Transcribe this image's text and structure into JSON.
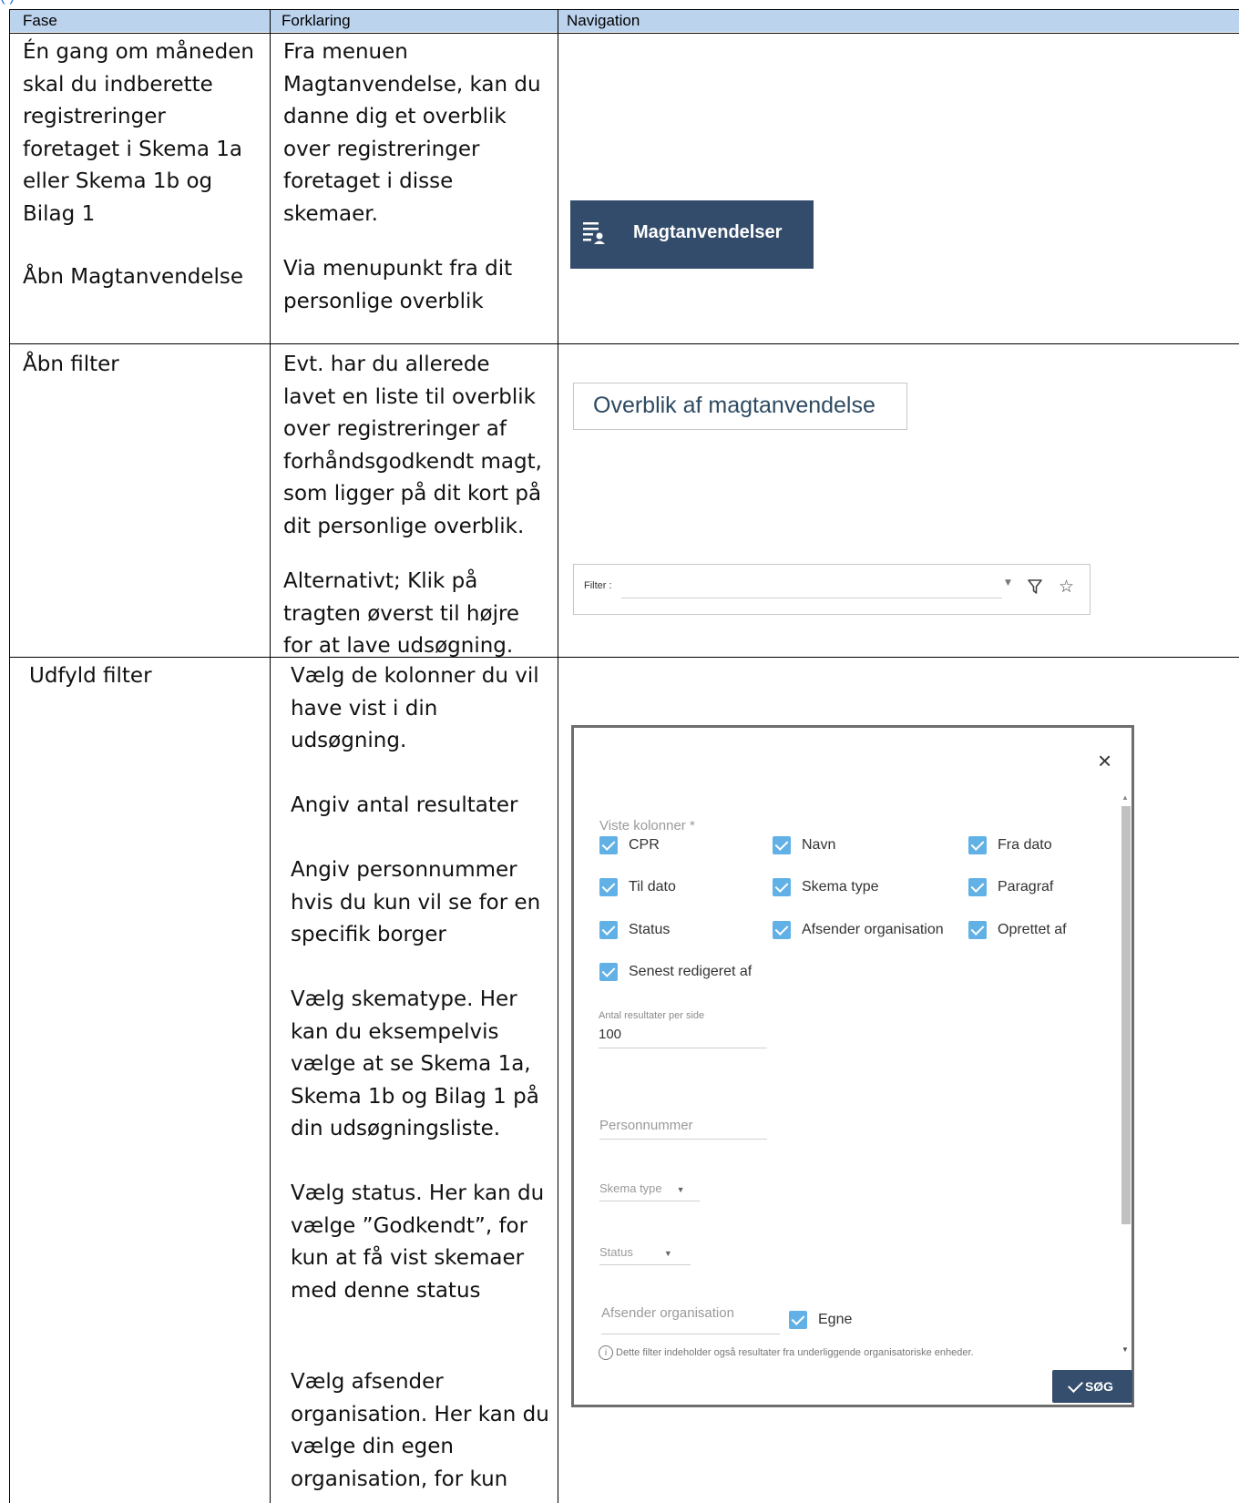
{
  "top_fragment": "(   )",
  "table": {
    "headers": [
      "Fase",
      "Forklaring",
      "Navigation"
    ],
    "rows": [
      {
        "fase": "Én gang om måneden skal du indberette registreringer foretaget i Skema 1a eller Skema 1b og Bilag 1",
        "fase2": "Åbn Magtanvendelse",
        "forklaring": "Fra menuen Magtanvendelse, kan du danne dig et overblik over registreringer foretaget i disse skemaer.",
        "forklaring2": "Via menupunkt fra dit personlige overblik"
      },
      {
        "fase": "Åbn filter",
        "forklaring": "Evt. har du allerede lavet en liste til overblik over registreringer af forhåndsgodkendt magt, som ligger på dit kort på dit personlige overblik.",
        "forklaring2": "Alternativt; Klik på tragten øverst til højre for at lave udsøgning."
      },
      {
        "fase": "Udfyld filter",
        "forklaring_items": [
          "Vælg de kolonner du vil have vist i din udsøgning.",
          "Angiv antal resultater",
          "Angiv personnummer hvis du kun vil se for en specifik borger",
          "Vælg skematype. Her kan du eksempelvis vælge at se Skema 1a, Skema 1b og Bilag 1 på din udsøgningsliste.",
          "Vælg status. Her kan du vælge ”Godkendt”, for kun at få vist skemaer med denne status",
          "Vælg afsender organisation. Her kan du vælge din egen organisation, for kun"
        ]
      }
    ]
  },
  "menu_button": {
    "label": "Magtanvendelser",
    "icon": "list-person-icon"
  },
  "overblik_card": {
    "label": "Overblik af magtanvendelse"
  },
  "filter_bar": {
    "label": "Filter :",
    "icons": [
      "funnel-icon",
      "star-icon"
    ]
  },
  "dialog": {
    "close": "×",
    "columns_label": "Viste kolonner *",
    "columns": [
      "CPR",
      "Navn",
      "Fra dato",
      "Til dato",
      "Skema type",
      "Paragraf",
      "Status",
      "Afsender organisation",
      "Oprettet af",
      "Senest redigeret af"
    ],
    "results_label": "Antal resultater per side",
    "results_value": "100",
    "personnummer_placeholder": "Personnummer",
    "skema_type_placeholder": "Skema type",
    "status_placeholder": "Status",
    "afsender_placeholder": "Afsender organisation",
    "egne_label": "Egne",
    "note": "Dette filter indeholder også resultater fra underliggende organisatoriske enheder.",
    "search_button": "SØG",
    "checkbox_color": "#62b1e6",
    "button_color": "#354e6d"
  }
}
